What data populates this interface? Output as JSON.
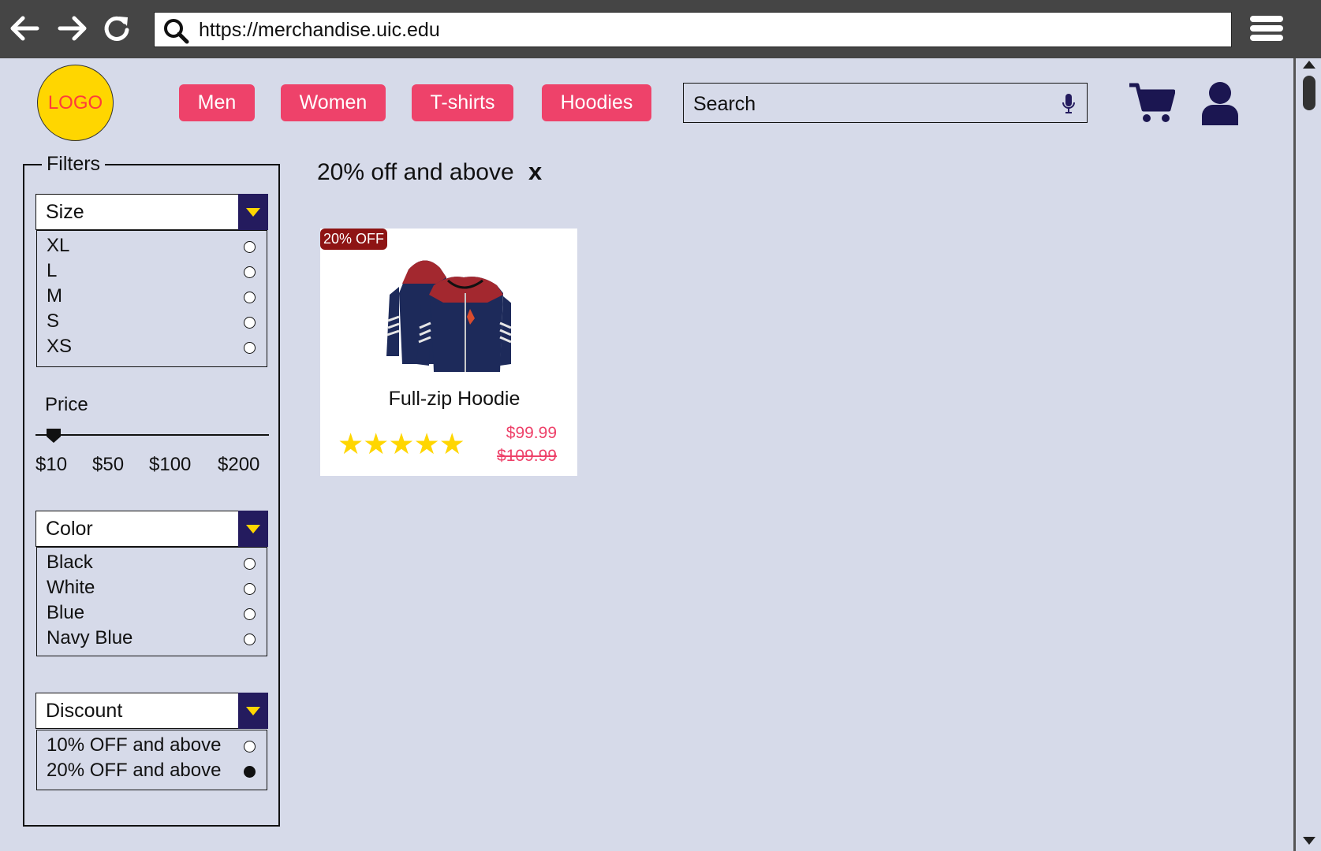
{
  "browser": {
    "url": "https://merchandise.uic.edu",
    "icons": [
      "back-arrow-icon",
      "forward-arrow-icon",
      "reload-icon",
      "search-icon",
      "hamburger-menu-icon"
    ]
  },
  "header": {
    "logo_text": "LOGO",
    "nav": [
      {
        "label": "Men"
      },
      {
        "label": "Women"
      },
      {
        "label": "T-shirts"
      },
      {
        "label": "Hoodies"
      }
    ],
    "search_placeholder": "Search",
    "icons": [
      "microphone-icon",
      "cart-icon",
      "user-icon"
    ]
  },
  "filters": {
    "title": "Filters",
    "size": {
      "label": "Size",
      "options": [
        "XL",
        "L",
        "M",
        "S",
        "XS"
      ]
    },
    "price": {
      "label": "Price",
      "ticks": [
        "$10",
        "$50",
        "$100",
        "$200"
      ]
    },
    "color": {
      "label": "Color",
      "options": [
        "Black",
        "White",
        "Blue",
        "Navy Blue"
      ]
    },
    "discount": {
      "label": "Discount",
      "options": [
        "10% OFF and above",
        "20% OFF and above"
      ],
      "selected": "20% OFF and above"
    }
  },
  "results": {
    "active_filter": "20% off and above",
    "clear_label": "x",
    "products": [
      {
        "badge": "20% OFF",
        "name": "Full-zip Hoodie",
        "rating": 5,
        "stars": "★★★★★",
        "price": "$99.99",
        "original_price": "$109.99"
      }
    ]
  },
  "colors": {
    "page_bg": "#d6dae9",
    "accent": "#ee426a",
    "dropdown_button": "#241b5e",
    "logo": "#ffd600",
    "badge": "#8e1414"
  }
}
